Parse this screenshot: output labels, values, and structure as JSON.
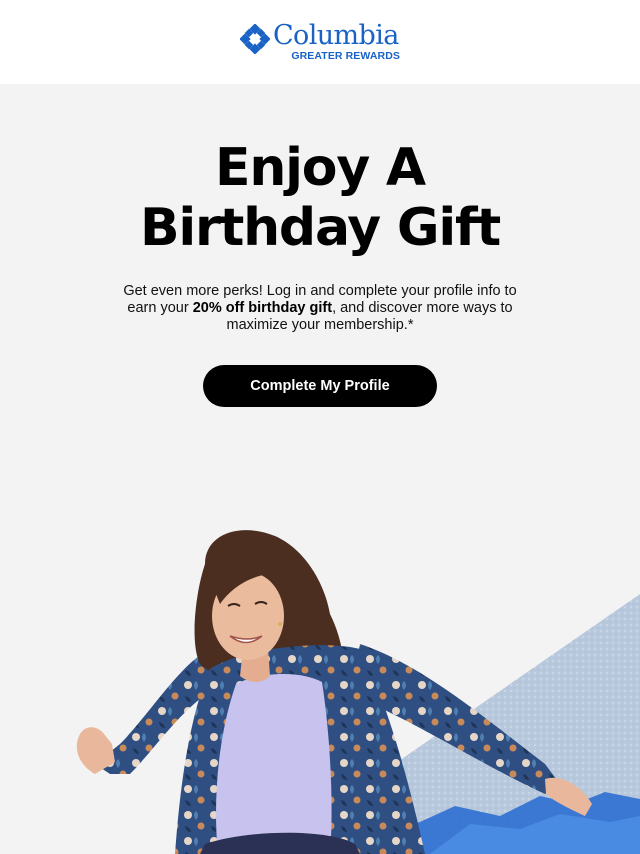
{
  "brand": {
    "name": "Columbia",
    "program": "GREATER REWARDS",
    "color": "#1a63c6"
  },
  "headline": {
    "line1": "Enjoy A",
    "line2": "Birthday Gift"
  },
  "body": {
    "part1": "Get even more perks! Log in and complete your profile info to earn your ",
    "bold": "20% off birthday gift",
    "part2": ", and discover more ways to maximize your membership.*"
  },
  "cta": {
    "label": "Complete My Profile"
  },
  "colors": {
    "background": "#f3f3f4",
    "header": "#ffffff",
    "button": "#000000",
    "button_text": "#ffffff"
  }
}
